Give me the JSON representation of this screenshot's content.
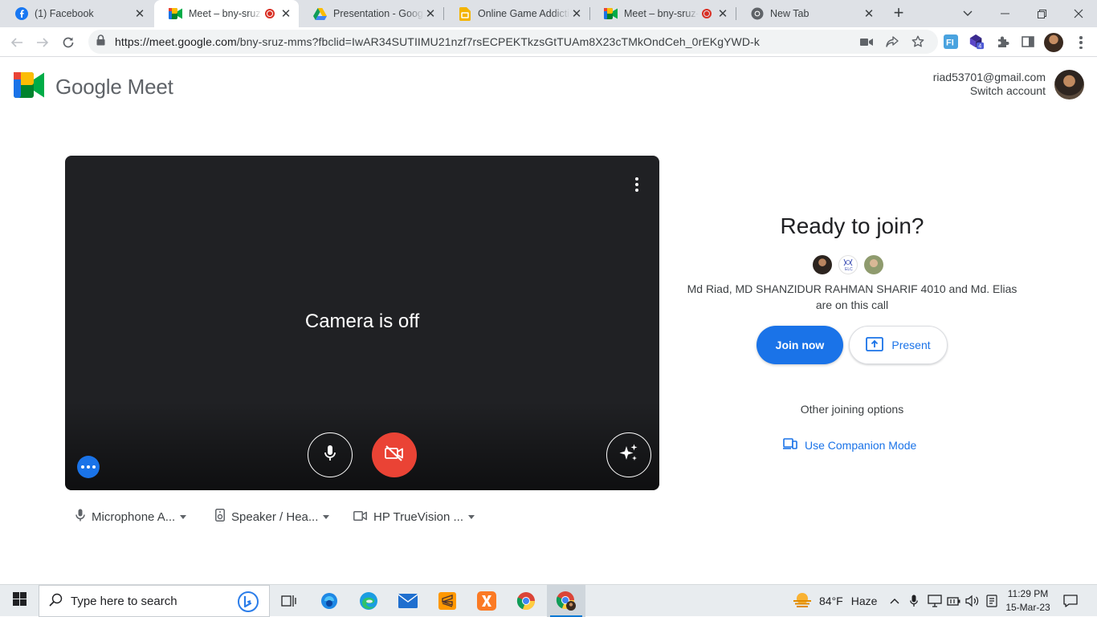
{
  "browser": {
    "tabs": [
      {
        "title": "(1) Facebook",
        "favicon": "facebook-icon",
        "active": false,
        "recording": false
      },
      {
        "title": "Meet – bny-sruz-mms",
        "favicon": "google-meet-icon",
        "active": true,
        "recording": true
      },
      {
        "title": "Presentation - Google Slides",
        "favicon": "google-drive-icon",
        "active": false,
        "recording": false
      },
      {
        "title": "Online Game Addiction",
        "favicon": "google-slides-icon",
        "active": false,
        "recording": false
      },
      {
        "title": "Meet – bny-sruz-mms",
        "favicon": "google-meet-icon",
        "active": false,
        "recording": true
      },
      {
        "title": "New Tab",
        "favicon": "chrome-icon",
        "active": false,
        "recording": false
      }
    ],
    "url_host": "https://meet.google.com",
    "url_path": "/bny-sruz-mms?fbclid=IwAR34SUTIIMU21nzf7rsECPEKTkzsGtTUAm8X23cTMkOndCeh_0rEKgYWD-k",
    "extension_badge": "4"
  },
  "meet": {
    "brand_name": "Google Meet",
    "account_email": "riad53701@gmail.com",
    "switch_account": "Switch account",
    "camera_status": "Camera is off",
    "ready_title": "Ready to join?",
    "call_note_line1": "Md Riad, MD SHANZIDUR RAHMAN SHARIF 4010 and Md. Elias",
    "call_note_line2": "are on this call",
    "join_label": "Join now",
    "present_label": "Present",
    "other_options": "Other joining options",
    "companion_label": "Use Companion Mode",
    "devices": {
      "microphone": "Microphone A...",
      "speaker": "Speaker / Hea...",
      "camera": "HP TrueVision ..."
    },
    "colors": {
      "accent": "#1a73e8",
      "camera_off": "#ea4335",
      "preview_bg": "#202124"
    }
  },
  "taskbar": {
    "search_placeholder": "Type here to search",
    "weather_temp": "84°F",
    "weather_desc": "Haze",
    "time": "11:29 PM",
    "date": "15-Mar-23"
  }
}
